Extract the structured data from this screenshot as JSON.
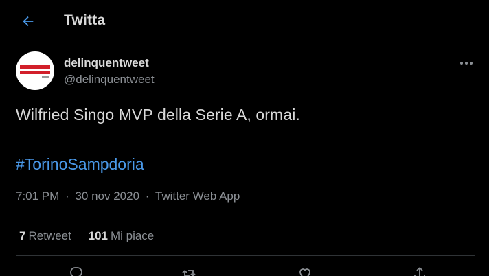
{
  "header": {
    "title": "Twitta",
    "back_icon": "arrow-left-icon"
  },
  "tweet": {
    "display_name": "delinquentweet",
    "handle": "@delinquentweet",
    "text": "Wilfried Singo MVP della Serie A, ormai.",
    "hashtag": "#TorinoSampdoria",
    "time": "7:01 PM",
    "separator": "·",
    "date": "30 nov 2020",
    "source": "Twitter Web App"
  },
  "stats": {
    "retweet_count": "7",
    "retweet_label": "Retweet",
    "like_count": "101",
    "like_label": "Mi piace"
  },
  "colors": {
    "background": "#000000",
    "text": "#d9d9d9",
    "muted": "#8b8f94",
    "accent": "#4a99e9",
    "divider": "#2f3336"
  },
  "icons": {
    "more": "more-horizontal-icon",
    "reply": "reply-icon",
    "retweet": "retweet-icon",
    "like": "heart-icon",
    "share": "share-icon"
  }
}
